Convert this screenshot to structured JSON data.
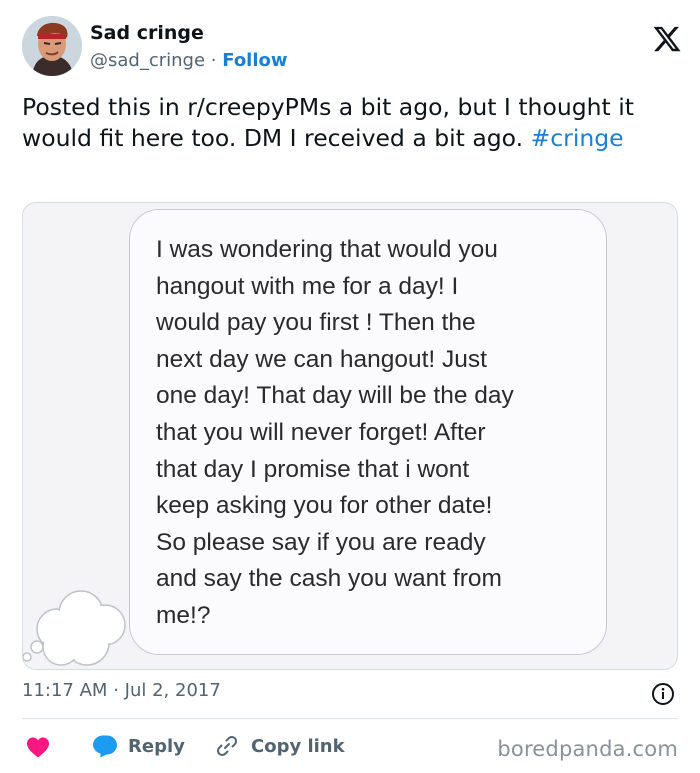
{
  "author": {
    "display_name": "Sad cringe",
    "handle": "@sad_cringe",
    "separator": "·",
    "follow_label": "Follow"
  },
  "icons": {
    "brand": "x-logo-icon",
    "avatar": "avatar-image",
    "sticker": "thought-cloud-icon",
    "info": "info-icon",
    "like": "heart-icon",
    "reply": "reply-bubble-icon",
    "copy": "link-icon"
  },
  "tweet": {
    "text": "Posted this in r/creepyPMs a bit ago, but I thought it would fit here too. DM I received a bit ago.",
    "hashtag": "#cringe"
  },
  "dm": {
    "lines": [
      "I was wondering that would you",
      "hangout with me for a day! I",
      "would pay you first ! Then the",
      "next day we can hangout! Just",
      "one day! That day will be the day",
      "that you will never forget! After",
      "that day I promise that i wont",
      "keep asking you for other date!",
      "So please say if you are ready",
      "and say the cash you want from",
      "me!?"
    ]
  },
  "meta": {
    "time": "11:17 AM",
    "separator": "·",
    "date": "Jul 2, 2017"
  },
  "actions": {
    "reply_label": "Reply",
    "copy_label": "Copy link"
  },
  "watermark": "boredpanda.com",
  "colors": {
    "link": "#1d7fd1",
    "like": "#f91880",
    "reply": "#1d9bf0",
    "muted": "#536471"
  }
}
